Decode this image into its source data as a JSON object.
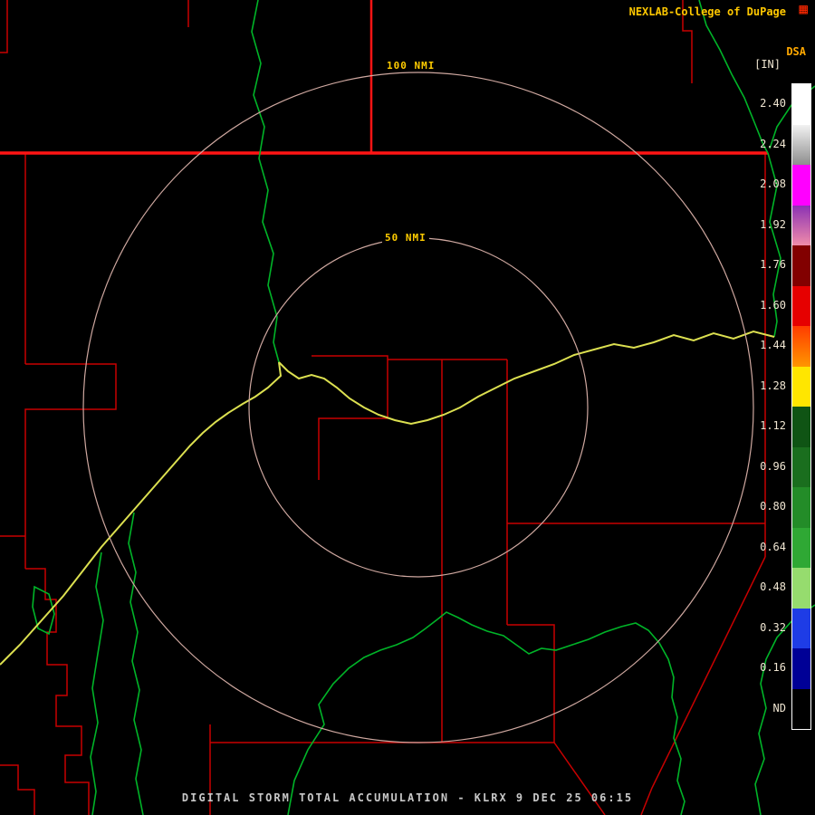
{
  "header": {
    "branding": "NEXLAB-College of DuPage",
    "logo_glyph": "▦"
  },
  "map": {
    "ring_labels": {
      "outer": "100 NMI",
      "inner": "50 NMI"
    }
  },
  "scale": {
    "product": "DSA",
    "units": "[IN]",
    "segments": [
      {
        "label": "2.40",
        "color": "#ffffff"
      },
      {
        "label": "2.24",
        "color": "#f2f2f2",
        "color2": "#8e8e8e"
      },
      {
        "label": "2.08",
        "color": "#ff00ff"
      },
      {
        "label": "1.92",
        "color": "#8c32b4",
        "color2": "#f08caa"
      },
      {
        "label": "1.76",
        "color": "#820000"
      },
      {
        "label": "1.60",
        "color": "#e60000"
      },
      {
        "label": "1.44",
        "color": "#ff3c00",
        "color2": "#ff9600"
      },
      {
        "label": "1.28",
        "color": "#ffe600"
      },
      {
        "label": "1.12",
        "color": "#0f5414"
      },
      {
        "label": "0.96",
        "color": "#1a6e1e"
      },
      {
        "label": "0.80",
        "color": "#238c28"
      },
      {
        "label": "0.64",
        "color": "#2fa834"
      },
      {
        "label": "0.48",
        "color": "#96dc6e"
      },
      {
        "label": "0.32",
        "color": "#1e3ce6"
      },
      {
        "label": "0.16",
        "color": "#000096"
      },
      {
        "label": "ND",
        "color": "#000000"
      }
    ]
  },
  "footer": {
    "title": "DIGITAL STORM TOTAL ACCUMULATION - KLRX 9 DEC 25 06:15"
  },
  "theme": {
    "bg": "#000000",
    "branding_text": "#ffc800",
    "logo": "#ff2800",
    "ring_label_text": "#ffcc00",
    "product_text": "#ffa800",
    "scale_text": "#f0e6d2",
    "footer_text": "#c8c8c8",
    "county_line": "#c80000",
    "state_border": "#ff1414",
    "river": "#00b428",
    "highlight_river": "#dce050",
    "range_ring": "#cfa8a0",
    "scale_border": "#ffffff"
  }
}
